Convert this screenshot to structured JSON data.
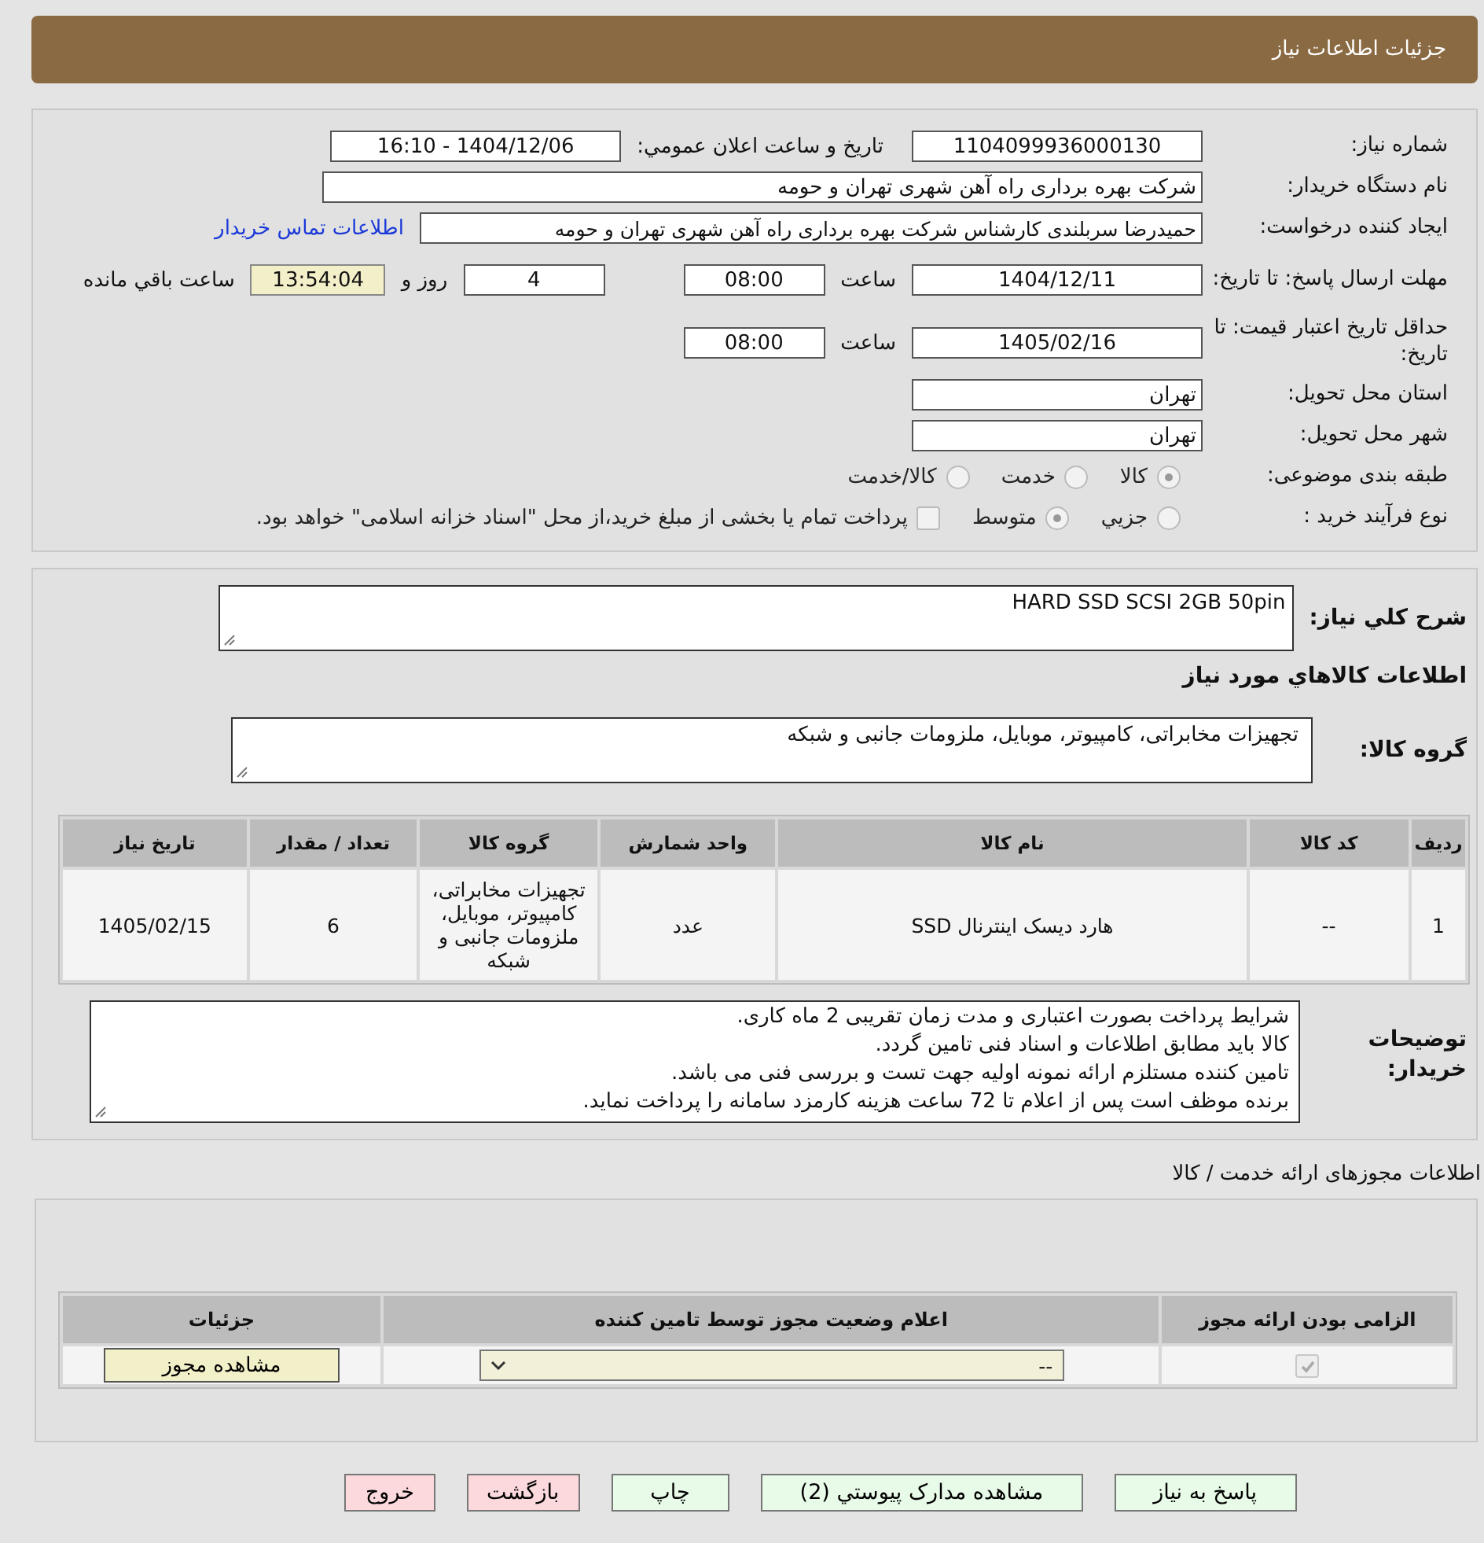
{
  "header": {
    "title": "جزئیات اطلاعات نیاز"
  },
  "details": {
    "need_number": {
      "label": "شماره نیاز:",
      "value": "1104099936000130"
    },
    "announce": {
      "label": "تاریخ و ساعت اعلان عمومي:",
      "value": "1404/12/06 - 16:10"
    },
    "buyer": {
      "label": "نام دستگاه خریدار:",
      "value": "شرکت بهره برداری راه آهن شهری تهران و حومه"
    },
    "creator": {
      "label": "ایجاد کننده درخواست:",
      "value": "حمیدرضا سربلندی کارشناس شرکت بهره برداری راه آهن شهری تهران و حومه",
      "link": "اطلاعات تماس خریدار"
    },
    "deadline": {
      "label": "مهلت ارسال پاسخ: تا تاریخ:",
      "date": "1404/12/11",
      "time_label": "ساعت",
      "time": "08:00",
      "days": "4",
      "days_label": "روز و",
      "remaining": "13:54:04",
      "remaining_label": "ساعت باقي مانده"
    },
    "validity": {
      "label": "حداقل تاریخ اعتبار قیمت: تا تاریخ:",
      "date": "1405/02/16",
      "time_label": "ساعت",
      "time": "08:00"
    },
    "province": {
      "label": "استان محل تحویل:",
      "value": "تهران"
    },
    "city": {
      "label": "شهر محل تحویل:",
      "value": "تهران"
    },
    "category": {
      "label": "طبقه بندی موضوعی:",
      "options": [
        {
          "label": "کالا",
          "selected": true
        },
        {
          "label": "خدمت",
          "selected": false
        },
        {
          "label": "کالا/خدمت",
          "selected": false
        }
      ]
    },
    "process": {
      "label": "نوع فرآیند خرید :",
      "options": [
        {
          "label": "جزيي",
          "selected": false
        },
        {
          "label": "متوسط",
          "selected": true
        }
      ],
      "treasury": {
        "checked": false,
        "label": "پرداخت تمام یا بخشی از مبلغ خرید،از محل \"اسناد خزانه اسلامی\" خواهد بود."
      }
    }
  },
  "goods": {
    "summary_label": "شرح كلي نياز:",
    "summary": "HARD SSD SCSI 2GB 50pin",
    "section_title": "اطلاعات کالاهاي مورد نياز",
    "group_label": "گروه کالا:",
    "group": "تجهیزات مخابراتی، کامپیوتر، موبایل، ملزومات جانبی و شبکه",
    "table": {
      "columns": [
        "ردیف",
        "کد کالا",
        "نام کالا",
        "واحد شمارش",
        "گروه کالا",
        "تعداد / مقدار",
        "تاریخ نیاز"
      ],
      "rows": [
        [
          "1",
          "--",
          "هارد دیسک اینترنال SSD",
          "عدد",
          "تجهیزات مخابراتی، کامپیوتر، موبایل، ملزومات جانبی و شبکه",
          "6",
          "1405/02/15"
        ]
      ]
    },
    "notes_label": "توضیحات خریدار:",
    "notes": [
      "شرایط پرداخت بصورت اعتباری و مدت زمان تقریبی 2 ماه کاری.",
      "کالا باید مطابق اطلاعات و اسناد فنی تامین گردد.",
      "تامین کننده مستلزم ارائه نمونه اولیه جهت تست و بررسی فنی می باشد.",
      "برنده موظف است پس از اعلام  تا 72 ساعت هزینه کارمزد سامانه را پرداخت نماید."
    ]
  },
  "licenses": {
    "title": "اطلاعات مجوزهای ارائه خدمت / کالا",
    "columns": [
      "الزامی بودن ارائه مجوز",
      "اعلام وضعیت مجوز توسط تامین کننده",
      "جزئیات"
    ],
    "rows": [
      {
        "required": true,
        "status": "--",
        "button": "مشاهده مجوز"
      }
    ]
  },
  "buttons": [
    {
      "label": "پاسخ به نیاز",
      "kind": "normal"
    },
    {
      "label": "مشاهده مدارک پیوستي (2)",
      "kind": "normal"
    },
    {
      "label": "چاپ",
      "kind": "normal"
    },
    {
      "label": "بازگشت",
      "kind": "danger"
    },
    {
      "label": "خروج",
      "kind": "danger"
    }
  ]
}
